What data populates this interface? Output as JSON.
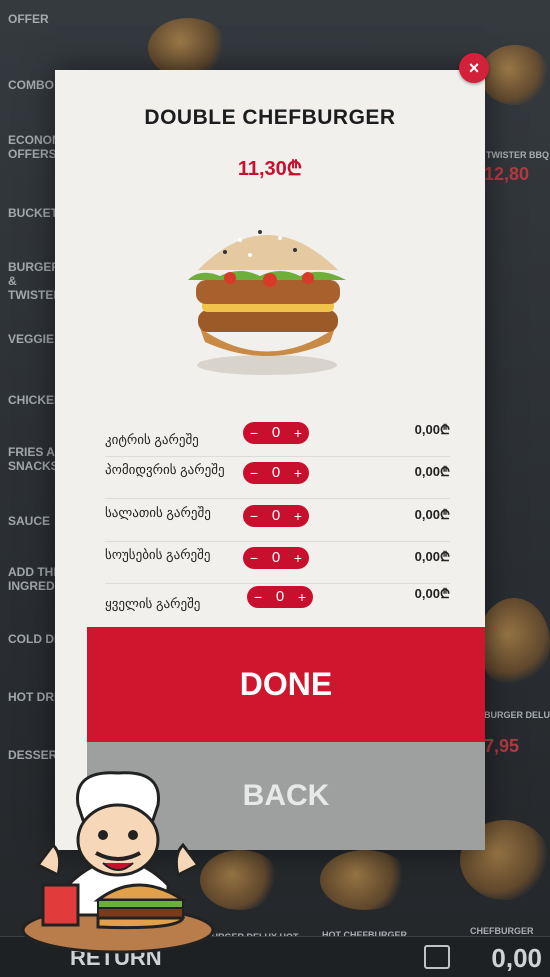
{
  "sidebar": {
    "categories": [
      "OFFER",
      "COMBO",
      "ECONOMY OFFERS",
      "BUCKETS",
      "BURGERS & TWISTERS",
      "VEGGIE",
      "CHICKEN",
      "FRIES AND SNACKS",
      "SAUCE",
      "ADD THE INGREDIENTS",
      "COLD DRINKS",
      "HOT DRINKS",
      "DESSERTS"
    ]
  },
  "background": {
    "item_label_1": "TWISTER BBQ",
    "item_price_1": "12,80",
    "item_label_2": "BURGER DELUX SPICY",
    "item_price_2": "7,95",
    "item_label_3": "BURGER DELUX HOT",
    "item_label_4": "HOT CHEFBURGER",
    "item_label_5": "CHEFBURGER",
    "footer_return": "RETURN",
    "footer_total": "0,00"
  },
  "modal": {
    "title": "DOUBLE CHEFBURGER",
    "price": "11,30₾",
    "options": [
      {
        "label": "კიტრის გარეშე",
        "qty": "0",
        "price": "0,00₾"
      },
      {
        "label": "პომიდვრის გარეშე",
        "qty": "0",
        "price": "0,00₾"
      },
      {
        "label": "სალათის გარეშე",
        "qty": "0",
        "price": "0,00₾"
      },
      {
        "label": "სოუსების გარეშე",
        "qty": "0",
        "price": "0,00₾"
      },
      {
        "label": "ყველის გარეშე",
        "qty": "0",
        "price": "0,00₾"
      }
    ],
    "minus": "−",
    "plus": "+",
    "done_label": "DONE",
    "back_label": "BACK",
    "close": "×"
  },
  "colors": {
    "accent": "#c8102e",
    "done_bg": "#d0162f",
    "back_bg": "#9ea0a0",
    "modal_bg": "#f1f0ec"
  }
}
